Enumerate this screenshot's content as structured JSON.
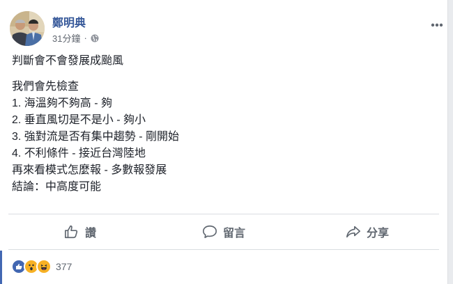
{
  "post": {
    "author": "鄭明典",
    "time": "31分鐘",
    "separator": "·",
    "lines_para1": [
      "判斷會不會發展成颱風"
    ],
    "lines_para2": [
      "我們會先檢查",
      "1. 海溫夠不夠高 - 夠",
      "2. 垂直風切是不是小 - 夠小",
      "3. 強對流是否有集中趨勢 - 剛開始",
      "4. 不利條件 - 接近台灣陸地",
      "再來看模式怎麼報 - 多數報發展",
      "結論：中高度可能"
    ]
  },
  "actions": {
    "like": "讚",
    "comment": "留言",
    "share": "分享"
  },
  "reactions": {
    "count": "377",
    "types": [
      "like-icon",
      "wow-icon",
      "haha-icon"
    ]
  },
  "colors": {
    "author": "#365899",
    "like_blue": "#4267b2",
    "emoji_yellow": "#f7b125"
  }
}
